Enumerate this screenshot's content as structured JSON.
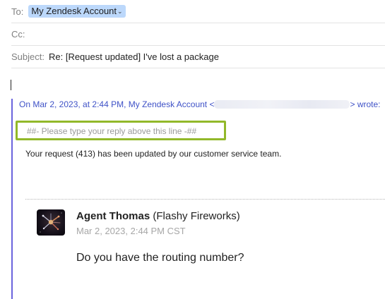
{
  "header": {
    "to_label": "To:",
    "to_recipient": "My Zendesk Account",
    "cc_label": "Cc:",
    "subject_label": "Subject:",
    "subject_value": "Re: [Request updated] I've lost a package"
  },
  "quote": {
    "attribution_prefix": "On Mar 2, 2023, at 2:44 PM, My Zendesk Account <",
    "attribution_suffix": "> wrote:",
    "reply_line": "##- Please type your reply above this line -##",
    "update_text": "Your request (413) has been updated by our customer service team.",
    "agent_name": "Agent Thomas",
    "agent_org": "(Flashy Fireworks)",
    "agent_date": "Mar 2, 2023, 2:44 PM CST",
    "message": "Do you have the routing number?"
  },
  "colors": {
    "recipient_token": "#bcd8fb",
    "quote_bar": "#6a64dd",
    "attribution": "#3f52c7",
    "highlight_box": "#92b82a"
  }
}
